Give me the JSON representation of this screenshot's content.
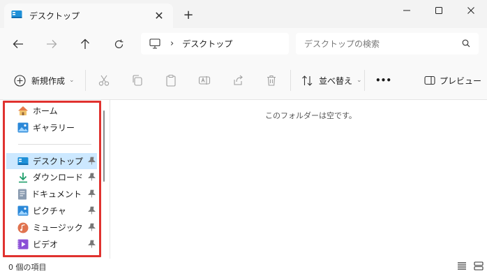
{
  "tab": {
    "title": "デスクトップ",
    "close": "✕",
    "new_tab": "+"
  },
  "window": {
    "minimize": "minimize",
    "maximize": "maximize",
    "close": "close"
  },
  "address": {
    "path_separator": "›",
    "location": "デスクトップ"
  },
  "search": {
    "placeholder": "デスクトップの検索"
  },
  "toolbar": {
    "new_label": "新規作成",
    "sort_label": "並べ替え",
    "more": "•••",
    "preview_label": "プレビュー"
  },
  "sidebar": {
    "items": [
      {
        "label": "ホーム",
        "icon": "home-icon"
      },
      {
        "label": "ギャラリー",
        "icon": "gallery-icon"
      },
      {
        "label": "デスクトップ",
        "icon": "desktop-icon",
        "selected": true,
        "pinned": true
      },
      {
        "label": "ダウンロード",
        "icon": "download-icon",
        "pinned": true
      },
      {
        "label": "ドキュメント",
        "icon": "documents-icon",
        "pinned": true
      },
      {
        "label": "ピクチャ",
        "icon": "pictures-icon",
        "pinned": true
      },
      {
        "label": "ミュージック",
        "icon": "music-icon",
        "pinned": true
      },
      {
        "label": "ビデオ",
        "icon": "videos-icon",
        "pinned": true
      }
    ],
    "highlight_color": "#e0322f",
    "selected_color": "#cce8ff"
  },
  "content": {
    "empty_message": "このフォルダーは空です。"
  },
  "status": {
    "item_count": "0 個の項目"
  }
}
